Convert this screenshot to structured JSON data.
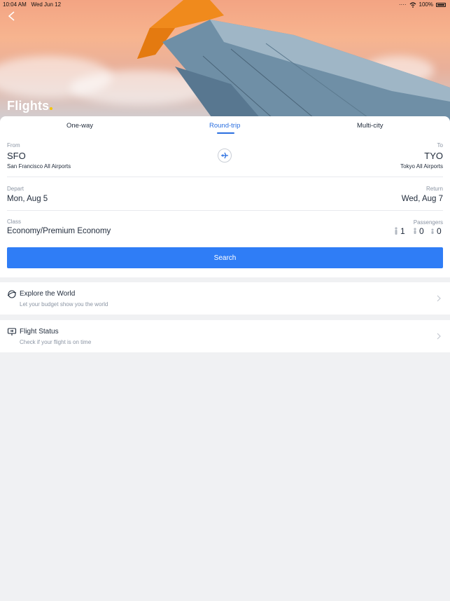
{
  "status_bar": {
    "time": "10:04 AM",
    "date": "Wed Jun 12",
    "battery": "100%"
  },
  "hero": {
    "title": "Flights"
  },
  "tabs": [
    {
      "label": "One-way",
      "active": false
    },
    {
      "label": "Round-trip",
      "active": true
    },
    {
      "label": "Multi-city",
      "active": false
    }
  ],
  "from": {
    "label": "From",
    "code": "SFO",
    "airport": "San Francisco All Airports"
  },
  "to": {
    "label": "To",
    "code": "TYO",
    "airport": "Tokyo All Airports"
  },
  "depart": {
    "label": "Depart",
    "date": "Mon, Aug 5"
  },
  "return": {
    "label": "Return",
    "date": "Wed, Aug 7"
  },
  "class": {
    "label": "Class",
    "value": "Economy/Premium Economy"
  },
  "passengers": {
    "label": "Passengers",
    "adults": "1",
    "children": "0",
    "infants": "0"
  },
  "search_button": "Search",
  "explore": {
    "title": "Explore the World",
    "subtitle": "Let your budget show you the world"
  },
  "flight_status": {
    "title": "Flight Status",
    "subtitle": "Check if your flight is on time"
  },
  "colors": {
    "accent": "#2f7df6",
    "active_tab": "#2a6fe0",
    "text": "#1f2a3a",
    "muted": "#8a94a3",
    "background": "#f0f1f3"
  }
}
